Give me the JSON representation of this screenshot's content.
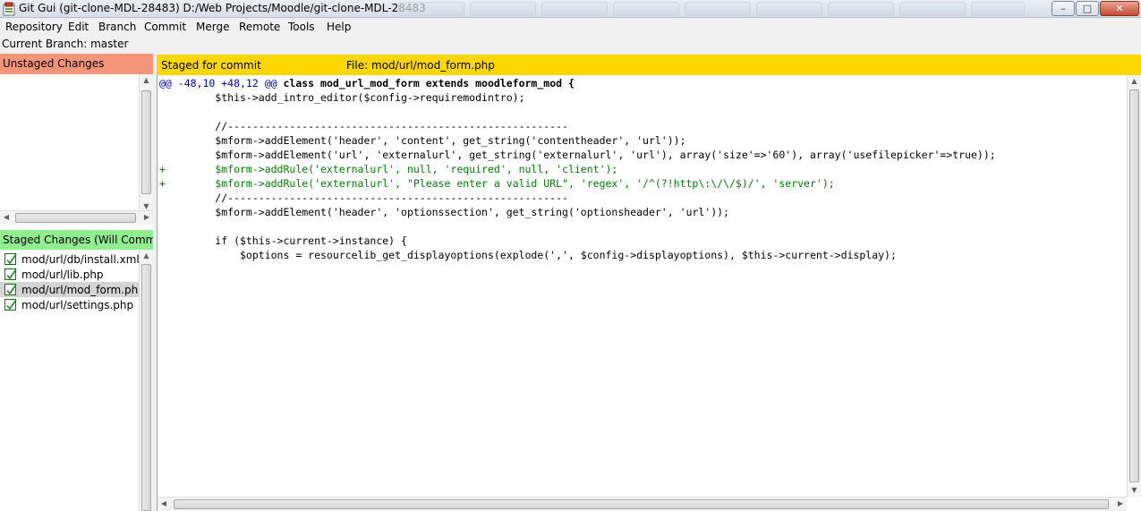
{
  "window": {
    "title": "Git Gui (git-clone-MDL-28483) D:/Web Projects/Moodle/git-clone-MDL-28483",
    "minimize_glyph": "–",
    "maximize_glyph": "□",
    "close_glyph": "✕"
  },
  "menu": {
    "items": [
      "Repository",
      "Edit",
      "Branch",
      "Commit",
      "Merge",
      "Remote",
      "Tools",
      "Help"
    ]
  },
  "branch": {
    "text": "Current Branch: master"
  },
  "unstaged": {
    "header": "Unstaged Changes",
    "header_color": "#f4957a",
    "files": []
  },
  "staged": {
    "header": "Staged Changes (Will Commit)",
    "header_color": "#90ee90",
    "files": [
      {
        "name": "mod/url/db/install.xml",
        "selected": false
      },
      {
        "name": "mod/url/lib.php",
        "selected": false
      },
      {
        "name": "mod/url/mod_form.php",
        "selected": true
      },
      {
        "name": "mod/url/settings.php",
        "selected": false
      }
    ]
  },
  "diff": {
    "status": "Staged for commit",
    "file_label": "File:",
    "file_name": "mod/url/mod_form.php",
    "header_color": "#ffd700",
    "hunk_meta": "@@ -48,10 +48,12 @@",
    "hunk_context": " class mod_url_mod_form extends moodleform_mod {",
    "lines": [
      {
        "type": "context",
        "text": "         $this->add_intro_editor($config->requiremodintro);"
      },
      {
        "type": "context",
        "text": " "
      },
      {
        "type": "context",
        "text": "         //-------------------------------------------------------"
      },
      {
        "type": "context",
        "text": "         $mform->addElement('header', 'content', get_string('contentheader', 'url'));"
      },
      {
        "type": "context",
        "text": "         $mform->addElement('url', 'externalurl', get_string('externalurl', 'url'), array('size'=>'60'), array('usefilepicker'=>true));"
      },
      {
        "type": "added",
        "text": "+        $mform->addRule('externalurl', null, 'required', null, 'client');"
      },
      {
        "type": "added",
        "text": "+        $mform->addRule('externalurl', \"Please enter a valid URL\", 'regex', '/^(?!http\\:\\/\\/$)/', 'server');"
      },
      {
        "type": "context",
        "text": "         //-------------------------------------------------------"
      },
      {
        "type": "context",
        "text": "         $mform->addElement('header', 'optionssection', get_string('optionsheader', 'url'));"
      },
      {
        "type": "context",
        "text": " "
      },
      {
        "type": "context",
        "text": "         if ($this->current->instance) {"
      },
      {
        "type": "context",
        "text": "             $options = resourcelib_get_displayoptions(explode(',', $config->displayoptions), $this->current->display);"
      }
    ]
  }
}
